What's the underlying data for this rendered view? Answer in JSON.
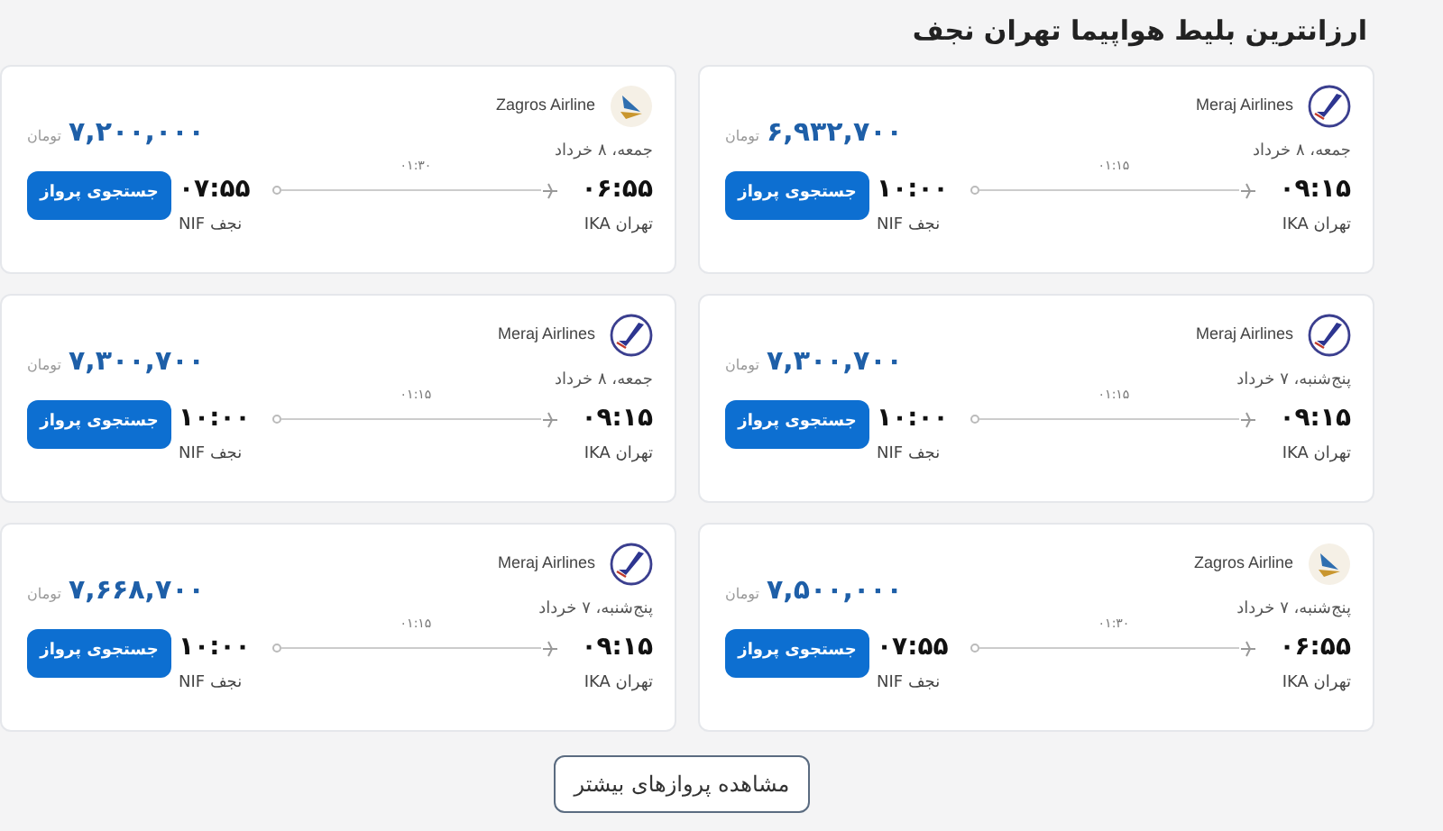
{
  "title": "ارزانترین بلیط هواپیما تهران نجف",
  "flights": [
    {
      "kind": "meraj",
      "airline": "Meraj Airlines",
      "date": "جمعه، ۸ خرداد",
      "departure": "۰۹:۱۵",
      "arrival": "۱۰:۰۰",
      "duration": "۰۱:۱۵",
      "origin": "تهران IKA",
      "destination": "نجف NIF",
      "price": "۶,۹۳۲,۷۰۰",
      "currency": "تومان",
      "button": "جستجوی پرواز"
    },
    {
      "kind": "zagros",
      "airline": "Zagros Airline",
      "date": "جمعه، ۸ خرداد",
      "departure": "۰۶:۵۵",
      "arrival": "۰۷:۵۵",
      "duration": "۰۱:۳۰",
      "origin": "تهران IKA",
      "destination": "نجف NIF",
      "price": "۷,۲۰۰,۰۰۰",
      "currency": "تومان",
      "button": "جستجوی پرواز"
    },
    {
      "kind": "meraj",
      "airline": "Meraj Airlines",
      "date": "پنج‌شنبه، ۷ خرداد",
      "departure": "۰۹:۱۵",
      "arrival": "۱۰:۰۰",
      "duration": "۰۱:۱۵",
      "origin": "تهران IKA",
      "destination": "نجف NIF",
      "price": "۷,۳۰۰,۷۰۰",
      "currency": "تومان",
      "button": "جستجوی پرواز"
    },
    {
      "kind": "meraj",
      "airline": "Meraj Airlines",
      "date": "جمعه، ۸ خرداد",
      "departure": "۰۹:۱۵",
      "arrival": "۱۰:۰۰",
      "duration": "۰۱:۱۵",
      "origin": "تهران IKA",
      "destination": "نجف NIF",
      "price": "۷,۳۰۰,۷۰۰",
      "currency": "تومان",
      "button": "جستجوی پرواز"
    },
    {
      "kind": "zagros",
      "airline": "Zagros Airline",
      "date": "پنج‌شنبه، ۷ خرداد",
      "departure": "۰۶:۵۵",
      "arrival": "۰۷:۵۵",
      "duration": "۰۱:۳۰",
      "origin": "تهران IKA",
      "destination": "نجف NIF",
      "price": "۷,۵۰۰,۰۰۰",
      "currency": "تومان",
      "button": "جستجوی پرواز"
    },
    {
      "kind": "meraj",
      "airline": "Meraj Airlines",
      "date": "پنج‌شنبه، ۷ خرداد",
      "departure": "۰۹:۱۵",
      "arrival": "۱۰:۰۰",
      "duration": "۰۱:۱۵",
      "origin": "تهران IKA",
      "destination": "نجف NIF",
      "price": "۷,۶۶۸,۷۰۰",
      "currency": "تومان",
      "button": "جستجوی پرواز"
    }
  ],
  "more_button": "مشاهده پروازهای بیشتر"
}
